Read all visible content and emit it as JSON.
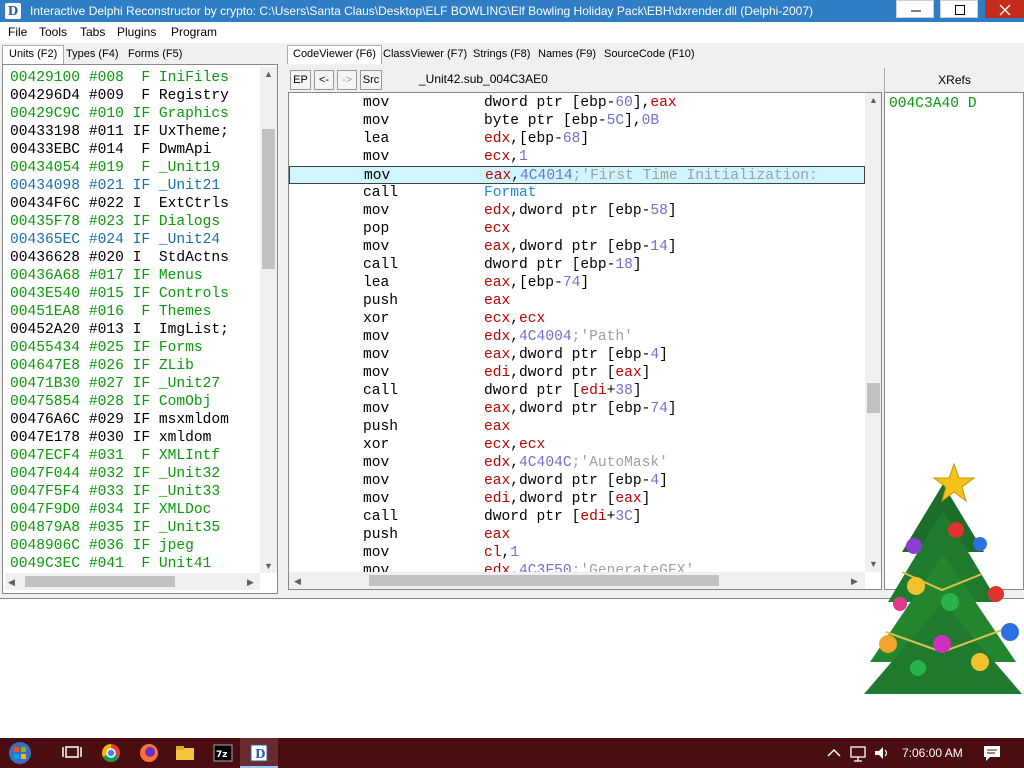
{
  "window": {
    "title": "Interactive Delphi Reconstructor by crypto: C:\\Users\\Santa Claus\\Desktop\\ELF BOWLING\\Elf Bowling Holiday Pack\\EBH\\dxrender.dll (Delphi-2007)",
    "app_icon_letter": "D"
  },
  "menu": {
    "items": [
      "File",
      "Tools",
      "Tabs",
      "Plugins",
      "Program"
    ]
  },
  "left_tabs": [
    "Units (F2)",
    "Types (F4)",
    "Forms (F5)"
  ],
  "units": [
    {
      "text": "00429100 #008  F IniFiles",
      "color": "#0a9a0a"
    },
    {
      "text": "004296D4 #009  F Registry",
      "color": "#000000"
    },
    {
      "text": "00429C9C #010 IF Graphics",
      "color": "#0a9a0a"
    },
    {
      "text": "00433198 #011 IF UxTheme;",
      "color": "#000000"
    },
    {
      "text": "00433EBC #014  F DwmApi",
      "color": "#000000"
    },
    {
      "text": "00434054 #019  F _Unit19",
      "color": "#0a9a0a"
    },
    {
      "text": "00434098 #021 IF _Unit21",
      "color": "#1a6fa8"
    },
    {
      "text": "00434F6C #022 I  ExtCtrls",
      "color": "#000000"
    },
    {
      "text": "00435F78 #023 IF Dialogs",
      "color": "#0a9a0a"
    },
    {
      "text": "004365EC #024 IF _Unit24",
      "color": "#1a6fa8"
    },
    {
      "text": "00436628 #020 I  StdActns",
      "color": "#000000"
    },
    {
      "text": "00436A68 #017 IF Menus",
      "color": "#0a9a0a"
    },
    {
      "text": "0043E540 #015 IF Controls",
      "color": "#0a9a0a"
    },
    {
      "text": "00451EA8 #016  F Themes",
      "color": "#0a9a0a"
    },
    {
      "text": "00452A20 #013 I  ImgList;",
      "color": "#000000"
    },
    {
      "text": "00455434 #025 IF Forms",
      "color": "#0a9a0a"
    },
    {
      "text": "004647E8 #026 IF ZLib",
      "color": "#0a9a0a"
    },
    {
      "text": "00471B30 #027 IF _Unit27",
      "color": "#0a9a0a"
    },
    {
      "text": "00475854 #028 IF ComObj",
      "color": "#0a9a0a"
    },
    {
      "text": "00476A6C #029 IF msxmldom",
      "color": "#000000"
    },
    {
      "text": "0047E178 #030 IF xmldom",
      "color": "#000000"
    },
    {
      "text": "0047ECF4 #031  F XMLIntf",
      "color": "#0a9a0a"
    },
    {
      "text": "0047F044 #032 IF _Unit32",
      "color": "#0a9a0a"
    },
    {
      "text": "0047F5F4 #033 IF _Unit33",
      "color": "#0a9a0a"
    },
    {
      "text": "0047F9D0 #034 IF XMLDoc",
      "color": "#0a9a0a"
    },
    {
      "text": "004879A8 #035 IF _Unit35",
      "color": "#0a9a0a"
    },
    {
      "text": "0048906C #036 IF jpeg",
      "color": "#0a9a0a"
    },
    {
      "text": "0049C3EC #041  F Unit41",
      "color": "#0a9a0a"
    }
  ],
  "main_tabs": [
    "CodeViewer (F6)",
    "ClassViewer (F7)",
    "Strings (F8)",
    "Names (F9)",
    "SourceCode (F10)"
  ],
  "code_toolbar": {
    "buttons": [
      "EP",
      "<-",
      "->",
      "Src"
    ],
    "title": "_Unit42.sub_004C3AE0"
  },
  "code": [
    {
      "op": "mov",
      "arg": [
        [
          "dword ptr [ebp-",
          "#000000"
        ],
        [
          "60",
          "#7070d0"
        ],
        [
          "],",
          "#000000"
        ],
        [
          "eax",
          "#c00000"
        ]
      ]
    },
    {
      "op": "mov",
      "arg": [
        [
          "byte ptr [ebp-",
          "#000000"
        ],
        [
          "5C",
          "#7070d0"
        ],
        [
          "],",
          "#000000"
        ],
        [
          "0B",
          "#7070d0"
        ]
      ]
    },
    {
      "op": "lea",
      "arg": [
        [
          "edx",
          "#c00000"
        ],
        [
          ",[ebp-",
          "#000000"
        ],
        [
          "68",
          "#7070d0"
        ],
        [
          "]",
          "#000000"
        ]
      ]
    },
    {
      "op": "mov",
      "arg": [
        [
          "ecx",
          "#c00000"
        ],
        [
          ",",
          "#000000"
        ],
        [
          "1",
          "#7070d0"
        ]
      ]
    },
    {
      "op": "mov",
      "arg": [
        [
          "eax",
          "#c00000"
        ],
        [
          ",",
          "#000000"
        ],
        [
          "4C4014",
          "#7070d0"
        ],
        [
          ";'First Time Initialization:",
          "#a0a0a0"
        ]
      ],
      "selected": true
    },
    {
      "op": "call",
      "arg": [
        [
          "Format",
          "#1a8ad4"
        ]
      ]
    },
    {
      "op": "mov",
      "arg": [
        [
          "edx",
          "#c00000"
        ],
        [
          ",dword ptr [ebp-",
          "#000000"
        ],
        [
          "58",
          "#7070d0"
        ],
        [
          "]",
          "#000000"
        ]
      ]
    },
    {
      "op": "pop",
      "arg": [
        [
          "ecx",
          "#c00000"
        ]
      ]
    },
    {
      "op": "mov",
      "arg": [
        [
          "eax",
          "#c00000"
        ],
        [
          ",dword ptr [ebp-",
          "#000000"
        ],
        [
          "14",
          "#7070d0"
        ],
        [
          "]",
          "#000000"
        ]
      ]
    },
    {
      "op": "call",
      "arg": [
        [
          "dword ptr [ebp-",
          "#000000"
        ],
        [
          "18",
          "#7070d0"
        ],
        [
          "]",
          "#000000"
        ]
      ]
    },
    {
      "op": "lea",
      "arg": [
        [
          "eax",
          "#c00000"
        ],
        [
          ",[ebp-",
          "#000000"
        ],
        [
          "74",
          "#7070d0"
        ],
        [
          "]",
          "#000000"
        ]
      ]
    },
    {
      "op": "push",
      "arg": [
        [
          "eax",
          "#c00000"
        ]
      ]
    },
    {
      "op": "xor",
      "arg": [
        [
          "ecx",
          "#c00000"
        ],
        [
          ",",
          "#000000"
        ],
        [
          "ecx",
          "#c00000"
        ]
      ]
    },
    {
      "op": "mov",
      "arg": [
        [
          "edx",
          "#c00000"
        ],
        [
          ",",
          "#000000"
        ],
        [
          "4C4004",
          "#7070d0"
        ],
        [
          ";'Path'",
          "#a0a0a0"
        ]
      ]
    },
    {
      "op": "mov",
      "arg": [
        [
          "eax",
          "#c00000"
        ],
        [
          ",dword ptr [ebp-",
          "#000000"
        ],
        [
          "4",
          "#7070d0"
        ],
        [
          "]",
          "#000000"
        ]
      ]
    },
    {
      "op": "mov",
      "arg": [
        [
          "edi",
          "#c00000"
        ],
        [
          ",dword ptr [",
          "#000000"
        ],
        [
          "eax",
          "#c00000"
        ],
        [
          "]",
          "#000000"
        ]
      ]
    },
    {
      "op": "call",
      "arg": [
        [
          "dword ptr [",
          "#000000"
        ],
        [
          "edi",
          "#c00000"
        ],
        [
          "+",
          "#000000"
        ],
        [
          "38",
          "#7070d0"
        ],
        [
          "]",
          "#000000"
        ]
      ]
    },
    {
      "op": "mov",
      "arg": [
        [
          "eax",
          "#c00000"
        ],
        [
          ",dword ptr [ebp-",
          "#000000"
        ],
        [
          "74",
          "#7070d0"
        ],
        [
          "]",
          "#000000"
        ]
      ]
    },
    {
      "op": "push",
      "arg": [
        [
          "eax",
          "#c00000"
        ]
      ]
    },
    {
      "op": "xor",
      "arg": [
        [
          "ecx",
          "#c00000"
        ],
        [
          ",",
          "#000000"
        ],
        [
          "ecx",
          "#c00000"
        ]
      ]
    },
    {
      "op": "mov",
      "arg": [
        [
          "edx",
          "#c00000"
        ],
        [
          ",",
          "#000000"
        ],
        [
          "4C404C",
          "#7070d0"
        ],
        [
          ";'AutoMask'",
          "#a0a0a0"
        ]
      ]
    },
    {
      "op": "mov",
      "arg": [
        [
          "eax",
          "#c00000"
        ],
        [
          ",dword ptr [ebp-",
          "#000000"
        ],
        [
          "4",
          "#7070d0"
        ],
        [
          "]",
          "#000000"
        ]
      ]
    },
    {
      "op": "mov",
      "arg": [
        [
          "edi",
          "#c00000"
        ],
        [
          ",dword ptr [",
          "#000000"
        ],
        [
          "eax",
          "#c00000"
        ],
        [
          "]",
          "#000000"
        ]
      ]
    },
    {
      "op": "call",
      "arg": [
        [
          "dword ptr [",
          "#000000"
        ],
        [
          "edi",
          "#c00000"
        ],
        [
          "+",
          "#000000"
        ],
        [
          "3C",
          "#7070d0"
        ],
        [
          "]",
          "#000000"
        ]
      ]
    },
    {
      "op": "push",
      "arg": [
        [
          "eax",
          "#c00000"
        ]
      ]
    },
    {
      "op": "mov",
      "arg": [
        [
          "cl",
          "#c00000"
        ],
        [
          ",",
          "#000000"
        ],
        [
          "1",
          "#7070d0"
        ]
      ]
    },
    {
      "op": "mov",
      "arg": [
        [
          "edx",
          "#c00000"
        ],
        [
          ",",
          "#000000"
        ],
        [
          "4C3F50",
          "#7070d0"
        ],
        [
          ";'GenerateGFX'",
          "#a0a0a0"
        ]
      ]
    }
  ],
  "xrefs": {
    "header": "XRefs",
    "items": [
      "004C3A40 D"
    ]
  },
  "taskbar": {
    "clock": "7:06:00 AM",
    "icons": [
      "start-orb-icon",
      "task-view-icon",
      "chrome-icon",
      "firefox-icon",
      "file-explorer-icon",
      "7zip-icon",
      "idr-icon"
    ],
    "tray_icons": [
      "chevron-up-icon",
      "network-icon",
      "volume-icon",
      "notification-icon"
    ]
  },
  "colors": {
    "title_bar": "#2f7dc4",
    "selection": "#cff6ff",
    "taskbar": "#4a0e12",
    "unit_green": "#0a9a0a",
    "unit_blue": "#1a6fa8"
  }
}
